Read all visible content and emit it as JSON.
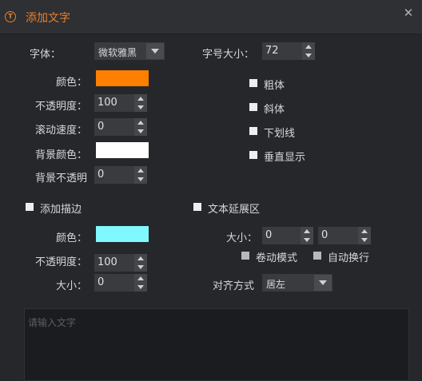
{
  "title": "添加文字",
  "font": {
    "label": "字体：",
    "value": "微软雅黑"
  },
  "font_size": {
    "label": "字号大小：",
    "value": "72"
  },
  "color": {
    "label": "颜色：",
    "value": "#ff7f00"
  },
  "opacity": {
    "label": "不透明度：",
    "value": "100"
  },
  "scroll_speed": {
    "label": "滚动速度：",
    "value": "0"
  },
  "bg_color": {
    "label": "背景颜色：",
    "value": "#ffffff"
  },
  "bg_opacity": {
    "label": "背景不透明",
    "value": "0"
  },
  "bold": {
    "label": "粗体"
  },
  "italic": {
    "label": "斜体"
  },
  "underline": {
    "label": "下划线"
  },
  "vertical": {
    "label": "垂直显示"
  },
  "stroke": {
    "label": "添加描边",
    "color_label": "颜色：",
    "color_value": "#80f8ff",
    "opacity_label": "不透明度：",
    "opacity_value": "100",
    "size_label": "大小：",
    "size_value": "0"
  },
  "text_extend": {
    "label": "文本延展区",
    "size_label": "大小：",
    "size_w": "0",
    "size_h": "0",
    "scroll_mode_label": "卷动模式",
    "auto_wrap_label": "自动换行",
    "align_label": "对齐方式",
    "align_value": "居左"
  },
  "text_input": {
    "placeholder": "请输入文字"
  },
  "colors": {
    "accent": "#ef7f25",
    "bg": "#26272b",
    "titlebar": "#2e3034"
  }
}
